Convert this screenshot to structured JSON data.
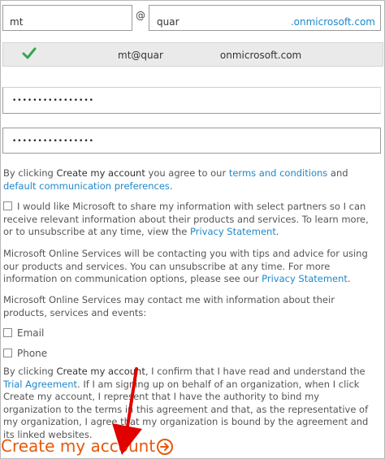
{
  "form": {
    "username_value": "mt",
    "at_sign": "@",
    "domain_prefix_value": "quar",
    "domain_suffix": ".onmicrosoft.com",
    "verified_email_prefix": "mt@quar",
    "verified_email_suffix": "onmicrosoft.com",
    "password_mask": "••••••••••••••••",
    "confirm_password_mask": "••••••••••••••••"
  },
  "terms": {
    "pre": "By clicking ",
    "cta": "Create my account",
    "mid": " you agree to our ",
    "terms_link": "terms and conditions",
    "and": " and ",
    "prefs_link": "default communication preferences",
    "end": "."
  },
  "partners": {
    "text": "I would like Microsoft to share my information with select partners so I can receive relevant information about their products and services. To learn more, or to unsubscribe at any time, view the ",
    "link": "Privacy Statement",
    "end": "."
  },
  "contact": {
    "text": "Microsoft Online Services will be contacting you with tips and advice for using our products and services. You can unsubscribe at any time. For more information on communication options, please see our ",
    "link": "Privacy Statement",
    "end": "."
  },
  "may_contact": {
    "text": "Microsoft Online Services may contact me with information about their products, services and events:"
  },
  "options": [
    {
      "label": "Email",
      "checked": false
    },
    {
      "label": "Phone",
      "checked": false
    }
  ],
  "agreement": {
    "pre": "By clicking ",
    "cta": "Create my account",
    "mid": ", I confirm that I have read and understand the ",
    "link": "Trial Agreement",
    "rest": ". If I am signing up on behalf of an organization, when I click Create my account, I represent that I have the authority to bind my organization to the terms in this agreement and that, as the representative of my organization, I agree that my organization is bound by the agreement and its linked websites."
  },
  "create_button": {
    "label": "Create my account",
    "icon": "arrow-right-circle-icon",
    "color": "#e7580c"
  },
  "annotation": {
    "icon": "red-pointer-arrow",
    "color": "#e00000"
  },
  "colors": {
    "link": "#1d88c9",
    "check": "#2fa84f"
  }
}
